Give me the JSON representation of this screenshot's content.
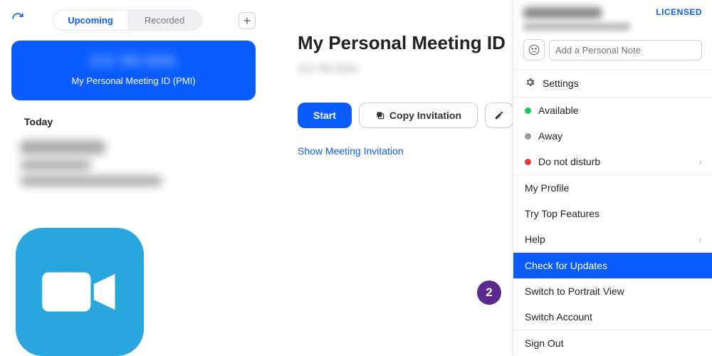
{
  "sidebar": {
    "tabs": {
      "upcoming": "Upcoming",
      "recorded": "Recorded"
    },
    "pmi": {
      "id_masked": "213 782 6291",
      "label": "My Personal Meeting ID (PMI)"
    },
    "today_label": "Today"
  },
  "main": {
    "title": "My Personal Meeting ID",
    "id_masked": "213 782 6291",
    "start_label": "Start",
    "copy_label": "Copy Invitation",
    "show_invite_label": "Show Meeting Invitation"
  },
  "profile": {
    "license": "LICENSED",
    "note_placeholder": "Add a Personal Note",
    "settings": "Settings",
    "status": {
      "available": "Available",
      "away": "Away",
      "dnd": "Do not disturb"
    },
    "my_profile": "My Profile",
    "try_top": "Try Top Features",
    "help": "Help",
    "check_updates": "Check for Updates",
    "switch_portrait": "Switch to Portrait View",
    "switch_account": "Switch Account",
    "sign_out": "Sign Out"
  },
  "annotation": {
    "step": "2"
  }
}
